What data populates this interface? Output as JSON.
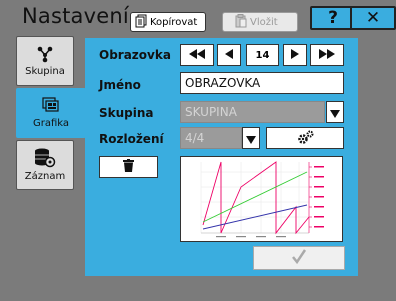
{
  "header": {
    "title": "Nastavení",
    "copy_label": "Kopírovat",
    "paste_label": "Vložit",
    "help_label": "?",
    "close_label": "✕"
  },
  "sidebar": {
    "items": [
      {
        "label": "Skupina"
      },
      {
        "label": "Grafika"
      },
      {
        "label": "Záznam"
      }
    ]
  },
  "form": {
    "screen_label": "Obrazovka",
    "screen_number": "14",
    "name_label": "Jméno",
    "name_value": "OBRAZOVKA",
    "group_label": "Skupina",
    "group_value": "SKUPINA",
    "layout_label": "Rozložení",
    "layout_value": "4/4"
  },
  "colors": {
    "accent": "#3aaddf",
    "background": "#7b7b7b"
  }
}
